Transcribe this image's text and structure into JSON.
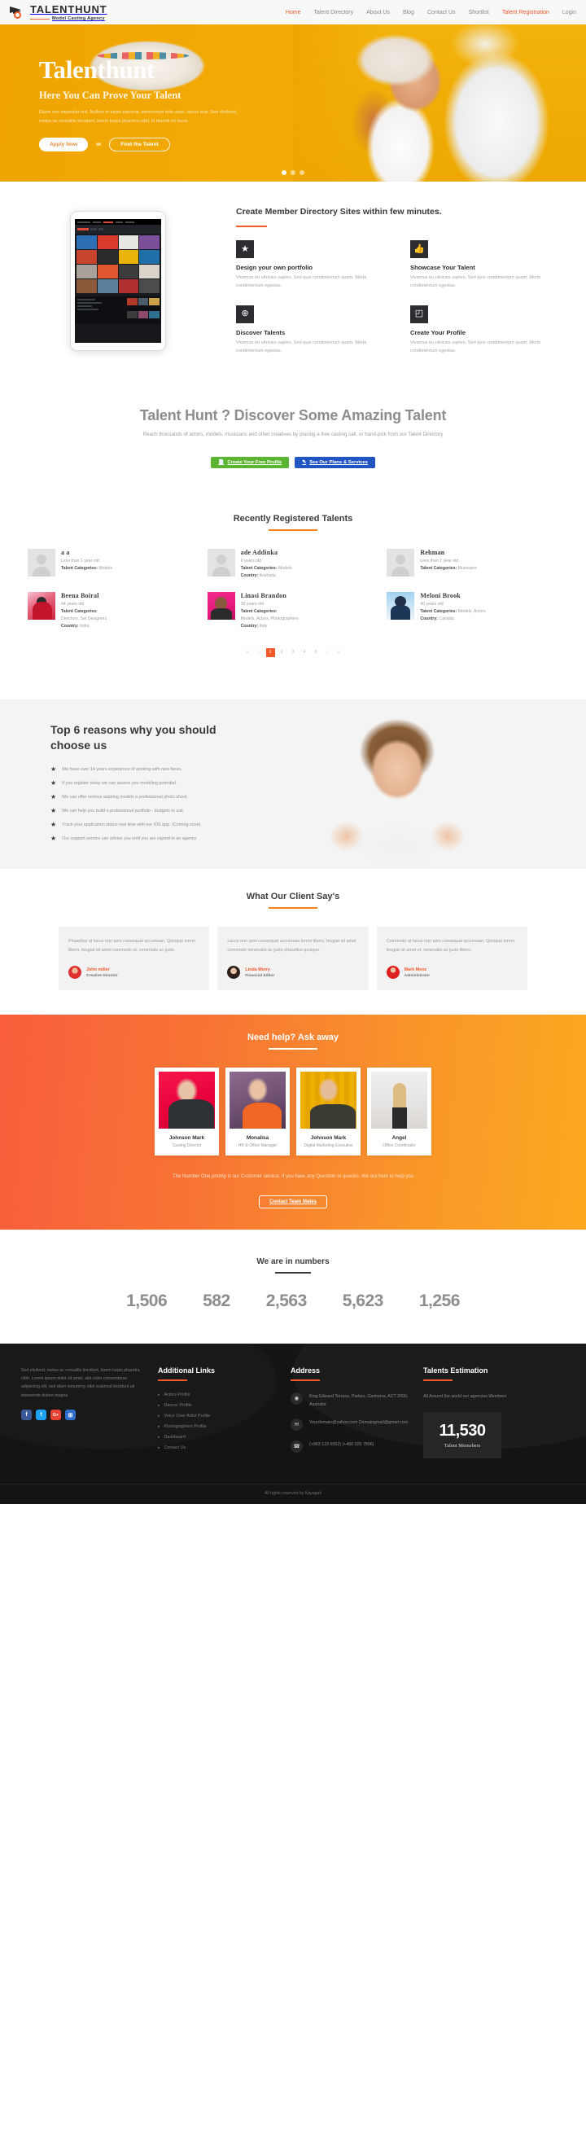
{
  "nav": {
    "brand_name": "TALENTHUNT",
    "brand_tagline": "Model Casting Agency",
    "links": [
      {
        "label": "Home",
        "active": true
      },
      {
        "label": "Talent Directory",
        "active": false
      },
      {
        "label": "About Us",
        "active": false
      },
      {
        "label": "Blog",
        "active": false
      },
      {
        "label": "Contact Us",
        "active": false
      },
      {
        "label": "Shortlist",
        "active": false
      },
      {
        "label": "Talent Registration",
        "active": true
      },
      {
        "label": "Login",
        "active": false
      }
    ]
  },
  "hero": {
    "title": "Talenthunt",
    "subtitle": "Here You Can Prove Your Talent",
    "description": "Etiam nec imperdiet nisl. Nullam in turpis placerat, elementum felis vitae, varius erat. Sed eleifend, metus ac convallis tincidunt, lorem turpis pharetra nibh, id blandit mi lacus .",
    "primary_button": "Apply Now",
    "or_label": "or",
    "secondary_button": "Find the Talent",
    "slides": 3,
    "active_slide": 1
  },
  "features": {
    "heading": "Create Member Directory Sites within few minutes.",
    "items": [
      {
        "icon": "star-icon",
        "glyph": "★",
        "title": "Design your own portfolio",
        "desc": "Vivamus eu ultricies sapien. Sed quis condimentum quam. Morbi condimentum egestas."
      },
      {
        "icon": "thumbs-up-icon",
        "glyph": "👍",
        "title": "Showcase Your Talent",
        "desc": "Vivamus eu ultricies sapien. Sed quis condimentum quam. Morbi condimentum egestas."
      },
      {
        "icon": "globe-icon",
        "glyph": "⊕",
        "title": "Discover Talents",
        "desc": "Vivamus eu ultricies sapien. Sed quis condimentum quam. Morbi condimentum egestas."
      },
      {
        "icon": "document-icon",
        "glyph": "◰",
        "title": "Create Your Profile",
        "desc": "Vivamus eu ultricies sapien. Sed quis condimentum quam. Morbi condimentum egestas."
      }
    ]
  },
  "discover": {
    "title": "Talent Hunt ? Discover Some Amazing Talent",
    "subtitle": "Reach thousands of actors, models, musicians and other creatives by placing a free casting call, or hand-pick from our Talent Directory",
    "btn_primary": "Create Your Free Profile",
    "btn_secondary": "See Our Plans & Services",
    "btn_primary_color": "#5cb531",
    "btn_secondary_color": "#2255c4"
  },
  "recent": {
    "title": "Recently Registered Talents",
    "labels": {
      "categories": "Talent Categories:",
      "country": "Country:"
    },
    "talents": [
      {
        "name": "a a",
        "age": "Less than 1 year old",
        "categories": "Models",
        "country": "",
        "avatar": "placeholder"
      },
      {
        "name": "ade Addinka",
        "age": "6 years old",
        "categories": "Models",
        "country": "Australia",
        "avatar": "placeholder"
      },
      {
        "name": "Rehman",
        "age": "Less than 1 year old",
        "categories": "Musicians",
        "country": "",
        "avatar": "placeholder"
      },
      {
        "name": "Beena Boiral",
        "age": "44 years old",
        "categories": "Directors, Set Designers",
        "country": "India",
        "avatar": "photo-red"
      },
      {
        "name": "Linasi Brandon",
        "age": "36 years old",
        "categories": "Models, Actors, Photographers",
        "country": "Italy",
        "avatar": "photo-pink"
      },
      {
        "name": "Meloni Brook",
        "age": "40 years old",
        "categories": "Models, Actors",
        "country": "Canada",
        "avatar": "photo-blue"
      }
    ],
    "pagination": [
      "«",
      "‹",
      "1",
      "2",
      "3",
      "4",
      "5",
      "›",
      "»"
    ],
    "active_page": "1"
  },
  "reasons": {
    "heading": "Top 6 reasons why you should choose us",
    "items": [
      "We have over 14 years experience of working with new faces.",
      "If you register today we can assess you modeling potential.",
      "We can offer serious aspiring models a professional photo shoot.",
      "We can help you build a professional portfolio - budgets to suit.",
      "Track your application status real time with our iOS app. (Coming soon)",
      "Our support service can advise you until you are signed to an agency"
    ]
  },
  "testimonials": {
    "title": "What Our Client Say's",
    "items": [
      {
        "text": "Phasellus at lacus non sem consequat accumsan. Quisque lorem libero, feugiat sit amet commodo et, venenatis ac justo.",
        "name": "John miller",
        "role": "Creative Director"
      },
      {
        "text": "Lacus non sem consequat accumsan lorem libero, feugiat sit amet commodo venenatis ac justo phasellus quisque.",
        "name": "Linda Merry",
        "role": "Financial Editor"
      },
      {
        "text": "Commodo at lacus non sem consequat accumsan. Quisque lorem feugiat sit amet et, venenatis ac justo libero.",
        "name": "Mark Menz",
        "role": "Administrator"
      }
    ]
  },
  "team": {
    "title": "Need help? Ask away",
    "members": [
      {
        "name": "Johnson Mark",
        "role": "Casting Director"
      },
      {
        "name": "Monalisa",
        "role": "HR & Office Manager"
      },
      {
        "name": "Johnson Mark",
        "role": "Digital Marketing Executive"
      },
      {
        "name": "Angel",
        "role": "Office Coordinator"
      }
    ],
    "note": "The Number One priority is our Customer service. If you have any Question or queries. We are here to help you",
    "button": "Contact Team Mates"
  },
  "numbers": {
    "title": "We are in numbers",
    "values": [
      "1,506",
      "582",
      "2,563",
      "5,623",
      "1,256"
    ]
  },
  "footer": {
    "about": "Sed eleifend, metus ac convallis tincidunt, lorem turpis pharetra nibh. Lorem ipsum dolor sit amet, alet ester consectetuer adipiscing elit, sed diam nonummy nibh euismod tincidunt uti lworeemte dolore magna",
    "social": [
      {
        "name": "facebook-icon",
        "glyph": "f",
        "color": "#3b5998"
      },
      {
        "name": "twitter-icon",
        "glyph": "t",
        "color": "#1da1f2"
      },
      {
        "name": "google-plus-icon",
        "glyph": "G+",
        "color": "#e94335"
      },
      {
        "name": "windows-icon",
        "glyph": "⊞",
        "color": "#2f6fd0"
      }
    ],
    "links_title": "Additional Links",
    "links": [
      "Actors Profile",
      "Dancer Profile",
      "Voice Over Artist Profile",
      "Photographers Profile",
      "Dashboard",
      "Contact Us"
    ],
    "address_title": "Address",
    "address_rows": [
      {
        "icon": "location-pin-icon",
        "glyph": "◉",
        "text": "King Edward Terrace, Parkes, Canberra, ACT 2600, Australia"
      },
      {
        "icon": "envelope-icon",
        "glyph": "✉",
        "text": "Yourdomain@yahoo.com Domaingmail@gmail.com"
      },
      {
        "icon": "mobile-phone-icon",
        "glyph": "☎",
        "text": "(+963 123 6952) (+456 025 7896)"
      }
    ],
    "estimation_title": "Talents Estimation",
    "estimation_note": "All Around the world our agencies Members",
    "estimation_number": "11,530",
    "estimation_label": "Talent Memebers",
    "copyright": "All rights reserved by Kayapati"
  }
}
